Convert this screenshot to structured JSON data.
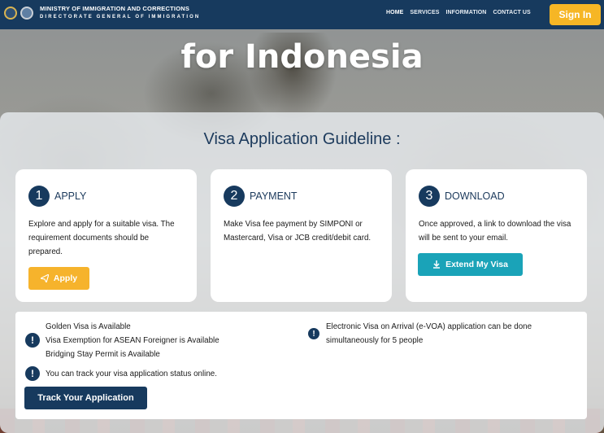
{
  "header": {
    "ministry_line1": "MINISTRY OF IMMIGRATION AND CORRECTIONS",
    "ministry_line2": "DIRECTORATE GENERAL OF IMMIGRATION",
    "nav": [
      "HOME",
      "SERVICES",
      "INFORMATION",
      "CONTACT US"
    ],
    "active_nav": "HOME",
    "sign_in_label": "Sign In"
  },
  "hero": {
    "title": "for Indonesia"
  },
  "guideline": {
    "title": "Visa Application Guideline :",
    "steps": [
      {
        "number": "1",
        "title": "APPLY",
        "text": "Explore and apply for a suitable visa. The requirement documents should be prepared.",
        "button_label": "Apply",
        "button_icon": "paper-plane-icon"
      },
      {
        "number": "2",
        "title": "PAYMENT",
        "text": "Make Visa fee payment by SIMPONI or Mastercard, Visa or JCB credit/debit card."
      },
      {
        "number": "3",
        "title": "DOWNLOAD",
        "text": "Once approved, a link to download the visa will be sent to your email.",
        "button_label": "Extend My Visa",
        "button_icon": "download-icon"
      }
    ]
  },
  "notices": {
    "left_group": [
      "Golden Visa is Available",
      "Visa Exemption for ASEAN Foreigner is Available",
      "Bridging Stay Permit is Available"
    ],
    "tracking_text": "You can track your visa application status online.",
    "right_line1": "Electronic Visa on Arrival (e-VOA) application can be done",
    "right_line2": "simultaneously for 5 people",
    "track_button_label": "Track Your Application"
  },
  "colors": {
    "navy": "#173a5e",
    "gold": "#f6b625",
    "teal": "#1aa3b8"
  }
}
